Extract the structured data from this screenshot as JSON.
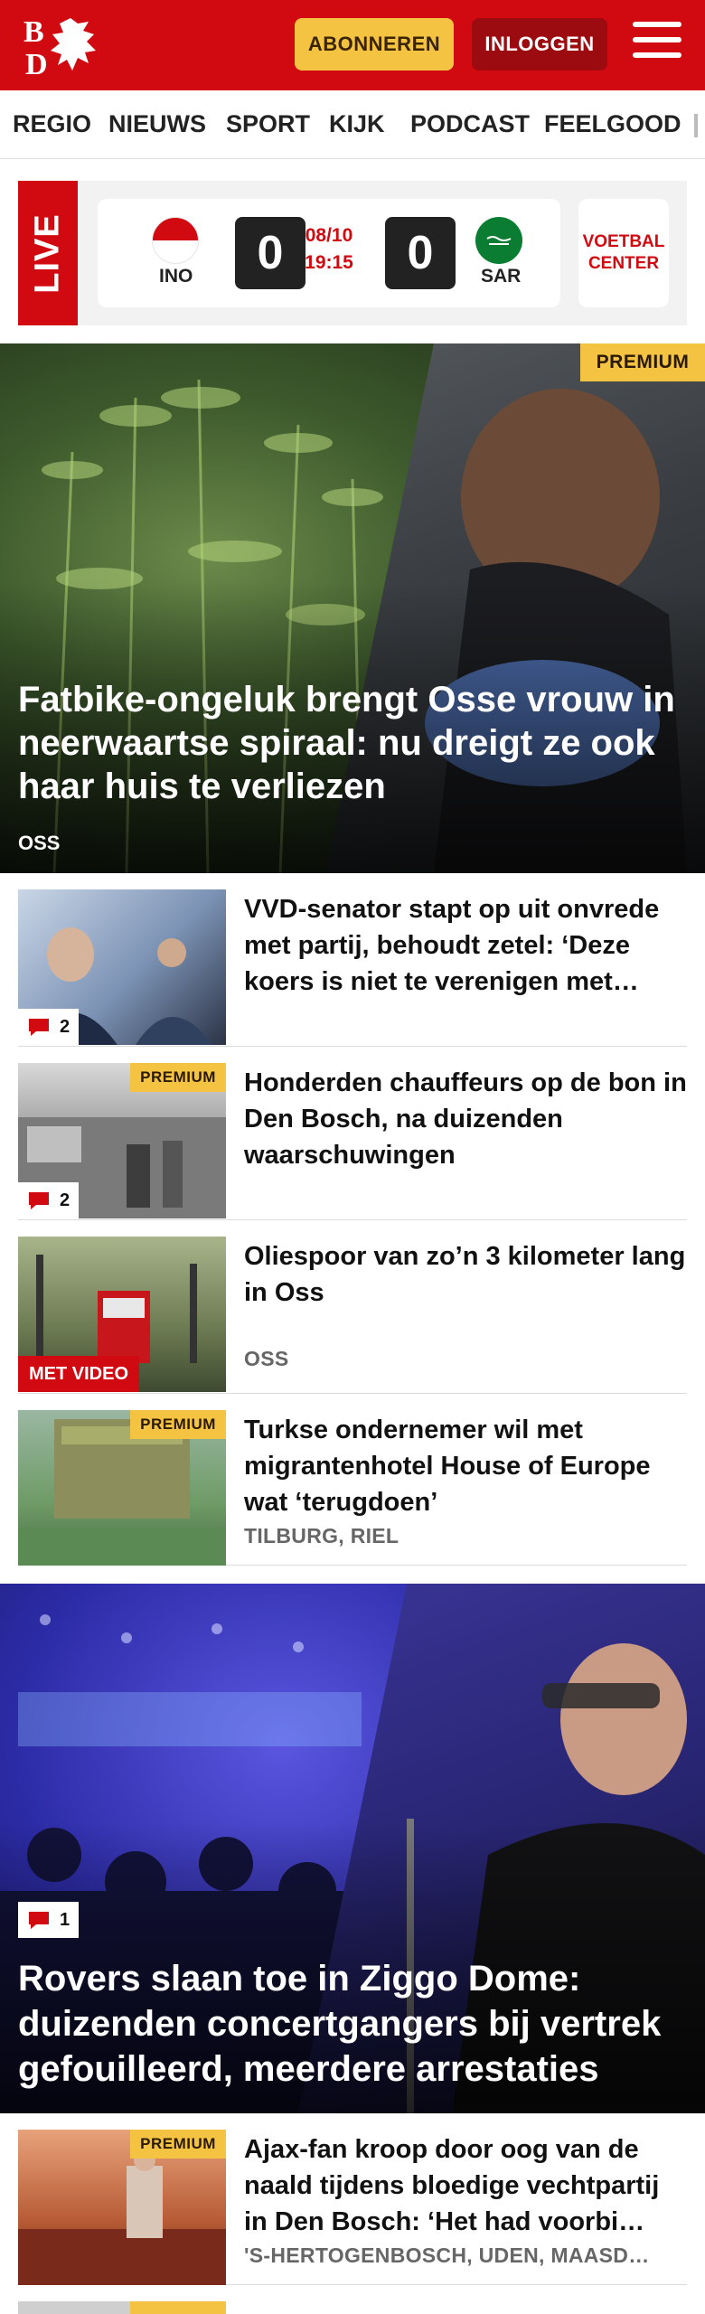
{
  "header": {
    "logo_letters": [
      "B",
      "D"
    ],
    "subscribe_label": "ABONNEREN",
    "login_label": "INLOGGEN"
  },
  "nav": {
    "items": [
      "REGIO",
      "NIEUWS",
      "SPORT",
      "KIJK",
      "PODCAST",
      "FEELGOOD"
    ]
  },
  "live": {
    "label": "LIVE",
    "home_team": "INO",
    "away_team": "SAR",
    "home_score": "0",
    "away_score": "0",
    "date": "08/10",
    "time": "19:15",
    "center_label_1": "VOETBAL",
    "center_label_2": "CENTER"
  },
  "hero": {
    "badge": "PREMIUM",
    "title": "Fatbike-ongeluk brengt Osse vrouw in neerwaartse spiraal: nu dreigt ze ook haar huis te verliezen",
    "location": "OSS"
  },
  "articles": [
    {
      "title": "VVD-senator stapt op uit onvrede met partij, behoudt zetel: ‘Deze koers is niet te verenigen met…",
      "comments": "2"
    },
    {
      "badge": "PREMIUM",
      "title": "Honderden chauffeurs op de bon in Den Bosch, na duizenden waarschuwingen",
      "comments": "2"
    },
    {
      "title": "Oliespoor van zo’n 3 kilometer lang in Oss",
      "location": "OSS",
      "video_label": "MET VIDEO"
    },
    {
      "badge": "PREMIUM",
      "title": "Turkse ondernemer wil met migrantenhotel House of Europe wat ‘terugdoen’",
      "location": "TILBURG, RIEL"
    }
  ],
  "hero2": {
    "comments": "1",
    "title": "Rovers slaan toe in Ziggo Dome: duizenden concertgangers bij vertrek gefouilleerd, meerdere arrestaties"
  },
  "bottom_article": {
    "badge": "PREMIUM",
    "title": "Ajax-fan kroop door oog van de naald tijdens bloedige vechtpar­tij in Den Bosch: ‘Het had voorbi…",
    "location": "'S-HERTOGENBOSCH, UDEN, MAASD…"
  },
  "colors": {
    "brand_red": "#d10a11",
    "premium_yellow": "#f5c342",
    "dark_red": "#9c0b10"
  }
}
